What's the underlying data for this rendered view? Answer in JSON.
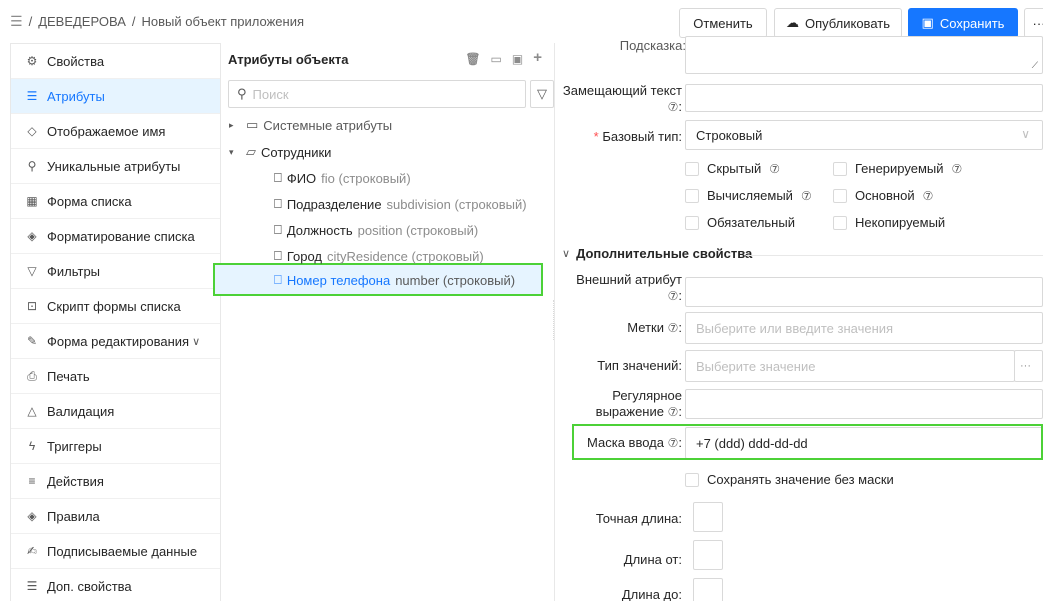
{
  "breadcrumb": {
    "menu_icon": "menu-icon",
    "sep1": "/",
    "project": "ДЕВЕДЕРОВА",
    "sep2": "/",
    "page": "Новый объект приложения"
  },
  "toolbar": {
    "cancel": "Отменить",
    "publish": "Опубликовать",
    "save": "Сохранить",
    "more": "···"
  },
  "sidebar": {
    "items": [
      {
        "label": "Свойства",
        "icon": "gear-icon"
      },
      {
        "label": "Атрибуты",
        "icon": "list-icon",
        "active": true
      },
      {
        "label": "Отображаемое имя",
        "icon": "tag-icon"
      },
      {
        "label": "Уникальные атрибуты",
        "icon": "search-icon"
      },
      {
        "label": "Форма списка",
        "icon": "table-icon"
      },
      {
        "label": "Форматирование списка",
        "icon": "paint-icon"
      },
      {
        "label": "Фильтры",
        "icon": "filter-icon"
      },
      {
        "label": "Скрипт формы списка",
        "icon": "terminal-icon"
      },
      {
        "label": "Форма редактирования",
        "icon": "edit-icon",
        "chevron": "∨"
      },
      {
        "label": "Печать",
        "icon": "printer-icon"
      },
      {
        "label": "Валидация",
        "icon": "warning-icon"
      },
      {
        "label": "Триггеры",
        "icon": "lightning-icon"
      },
      {
        "label": "Действия",
        "icon": "menu-icon"
      },
      {
        "label": "Правила",
        "icon": "diamond-icon"
      },
      {
        "label": "Подписываемые данные",
        "icon": "pen-icon"
      },
      {
        "label": "Доп. свойства",
        "icon": "list-icon"
      }
    ]
  },
  "tree": {
    "title": "Атрибуты объекта",
    "search_placeholder": "Поиск",
    "nodes": [
      {
        "name": "Системные атрибуты",
        "code": ""
      },
      {
        "name": "Сотрудники",
        "code": ""
      },
      {
        "name": "ФИО",
        "code": "fio (строковый)"
      },
      {
        "name": "Подразделение",
        "code": "subdivision (строковый)"
      },
      {
        "name": "Должность",
        "code": "position (строковый)"
      },
      {
        "name": "Город",
        "code": "cityResidence (строковый)"
      },
      {
        "name": "Номер телефона",
        "code": "number (строковый)"
      }
    ]
  },
  "form": {
    "hint_label": "Подсказка",
    "placeholder_label_1": "Замещающий текст",
    "base_type_label": "Базовый тип",
    "base_type_value": "Строковый",
    "checkboxes": {
      "hidden": "Скрытый",
      "generated": "Генерируемый",
      "computed": "Вычисляемый",
      "main": "Основной",
      "required": "Обязательный",
      "noncopy": "Некопируемый"
    },
    "section": "Дополнительные свойства",
    "external_label": "Внешний атрибут",
    "tags_label": "Метки",
    "tags_placeholder": "Выберите или введите значения",
    "value_type_label": "Тип значений",
    "value_type_placeholder": "Выберите значение",
    "regex_label_1": "Регулярное",
    "regex_label_2": "выражение",
    "mask_label": "Маска ввода",
    "mask_value": "+7 (ddd) ddd-dd-dd",
    "save_without_mask": "Сохранять значение без маски",
    "exact_length_label": "Точная длина",
    "length_from_label": "Длина от",
    "length_to_label": "Длина до",
    "colon": ":",
    "question": "⑦",
    "ellipsis": "···",
    "chevron": "∨",
    "section_chevron": "∨",
    "required_star": "*"
  },
  "colors": {
    "accent": "#1677ff",
    "highlight": "#4cd137",
    "active_bg": "#e6f4ff"
  }
}
